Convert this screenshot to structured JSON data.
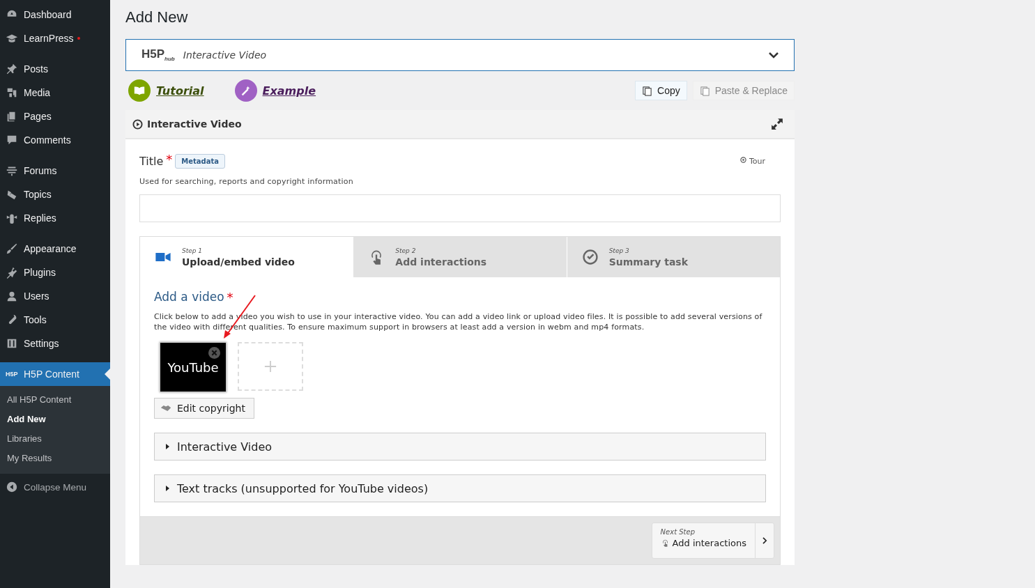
{
  "sidebar": {
    "groups": [
      [
        {
          "label": "Dashboard",
          "notification": false
        },
        {
          "label": "LearnPress",
          "notification": true
        }
      ],
      [
        {
          "label": "Posts",
          "notification": false
        },
        {
          "label": "Media",
          "notification": false
        },
        {
          "label": "Pages",
          "notification": false
        },
        {
          "label": "Comments",
          "notification": false
        }
      ],
      [
        {
          "label": "Forums",
          "notification": false
        },
        {
          "label": "Topics",
          "notification": false
        },
        {
          "label": "Replies",
          "notification": false
        }
      ],
      [
        {
          "label": "Appearance",
          "notification": false
        },
        {
          "label": "Plugins",
          "notification": false
        },
        {
          "label": "Users",
          "notification": false
        },
        {
          "label": "Tools",
          "notification": false
        },
        {
          "label": "Settings",
          "notification": false
        }
      ]
    ],
    "current": {
      "label": "H5P Content",
      "logo": "H5P"
    },
    "submenu": [
      {
        "label": "All H5P Content",
        "selected": false
      },
      {
        "label": "Add New",
        "selected": true
      },
      {
        "label": "Libraries",
        "selected": false
      },
      {
        "label": "My Results",
        "selected": false
      }
    ],
    "collapse": "Collapse Menu"
  },
  "page_title": "Add New",
  "hub": {
    "logo": "H5P",
    "logo_sub": "hub",
    "content_type": "Interactive Video"
  },
  "links": [
    {
      "label": "Tutorial",
      "color": "#7ea500"
    },
    {
      "label": "Example",
      "color": "#a061c4"
    }
  ],
  "actions": [
    {
      "label": "Copy",
      "disabled": false
    },
    {
      "label": "Paste & Replace",
      "disabled": true
    }
  ],
  "panel_title": "Interactive Video",
  "title_field": {
    "label": "Title",
    "required_mark": "*",
    "badge": "Metadata",
    "tour": "Tour",
    "description": "Used for searching, reports and copyright information"
  },
  "steps": [
    {
      "step": "Step 1",
      "label": "Upload/embed video",
      "selected": true
    },
    {
      "step": "Step 2",
      "label": "Add interactions",
      "selected": false
    },
    {
      "step": "Step 3",
      "label": "Summary task",
      "selected": false
    }
  ],
  "video": {
    "label": "Add a video",
    "required_mark": "*",
    "description": "Click below to add a video you wish to use in your interactive video. You can add a video link or upload video files. It is possible to add several versions of the video with different qualities. To ensure maximum support in browsers at least add a version in webm and mp4 formats.",
    "file": "YouTube",
    "copyright": "Edit copyright"
  },
  "sections": [
    {
      "label": "Interactive Video",
      "expanded": false
    },
    {
      "label": "Text tracks (unsupported for YouTube videos)",
      "expanded": false
    }
  ],
  "next": {
    "caption": "Next Step",
    "label": "Add interactions"
  }
}
